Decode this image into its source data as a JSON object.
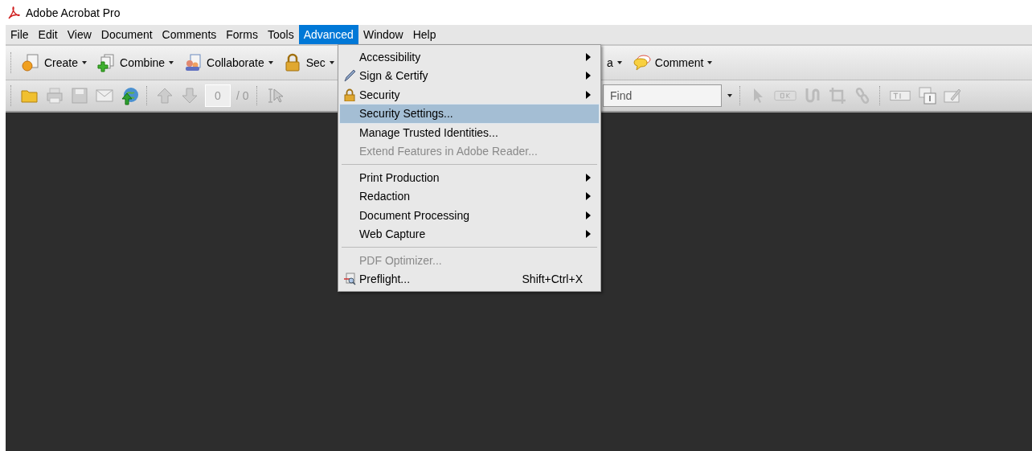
{
  "window": {
    "title": "Adobe Acrobat Pro"
  },
  "menubar": [
    {
      "label": "File",
      "selected": false
    },
    {
      "label": "Edit",
      "selected": false
    },
    {
      "label": "View",
      "selected": false
    },
    {
      "label": "Document",
      "selected": false
    },
    {
      "label": "Comments",
      "selected": false
    },
    {
      "label": "Forms",
      "selected": false
    },
    {
      "label": "Tools",
      "selected": false
    },
    {
      "label": "Advanced",
      "selected": true
    },
    {
      "label": "Window",
      "selected": false
    },
    {
      "label": "Help",
      "selected": false
    }
  ],
  "task_toolbar": [
    {
      "label": "Create"
    },
    {
      "label": "Combine"
    },
    {
      "label": "Collaborate"
    },
    {
      "label": "Sec"
    }
  ],
  "task_toolbar_right": [
    {
      "label": "a"
    },
    {
      "label": "Comment"
    }
  ],
  "page_nav": {
    "current": "0",
    "total": "/ 0"
  },
  "find": {
    "placeholder": "Find"
  },
  "advanced_menu": [
    {
      "kind": "item",
      "label": "Accessibility",
      "submenu": true,
      "disabled": false,
      "selected": false
    },
    {
      "kind": "item",
      "label": "Sign & Certify",
      "submenu": true,
      "disabled": false,
      "selected": false
    },
    {
      "kind": "item",
      "label": "Security",
      "submenu": true,
      "disabled": false,
      "selected": false
    },
    {
      "kind": "item",
      "label": "Security Settings...",
      "submenu": false,
      "disabled": false,
      "selected": true
    },
    {
      "kind": "item",
      "label": "Manage Trusted Identities...",
      "submenu": false,
      "disabled": false,
      "selected": false
    },
    {
      "kind": "item",
      "label": "Extend Features in Adobe Reader...",
      "submenu": false,
      "disabled": true,
      "selected": false
    },
    {
      "kind": "separator"
    },
    {
      "kind": "item",
      "label": "Print Production",
      "submenu": true,
      "disabled": false,
      "selected": false
    },
    {
      "kind": "item",
      "label": "Redaction",
      "submenu": true,
      "disabled": false,
      "selected": false
    },
    {
      "kind": "item",
      "label": "Document Processing",
      "submenu": true,
      "disabled": false,
      "selected": false
    },
    {
      "kind": "item",
      "label": "Web Capture",
      "submenu": true,
      "disabled": false,
      "selected": false
    },
    {
      "kind": "separator"
    },
    {
      "kind": "item",
      "label": "PDF Optimizer...",
      "submenu": false,
      "disabled": true,
      "selected": false
    },
    {
      "kind": "item",
      "label": "Preflight...",
      "submenu": false,
      "disabled": false,
      "selected": false,
      "shortcut": "Shift+Ctrl+X"
    }
  ]
}
